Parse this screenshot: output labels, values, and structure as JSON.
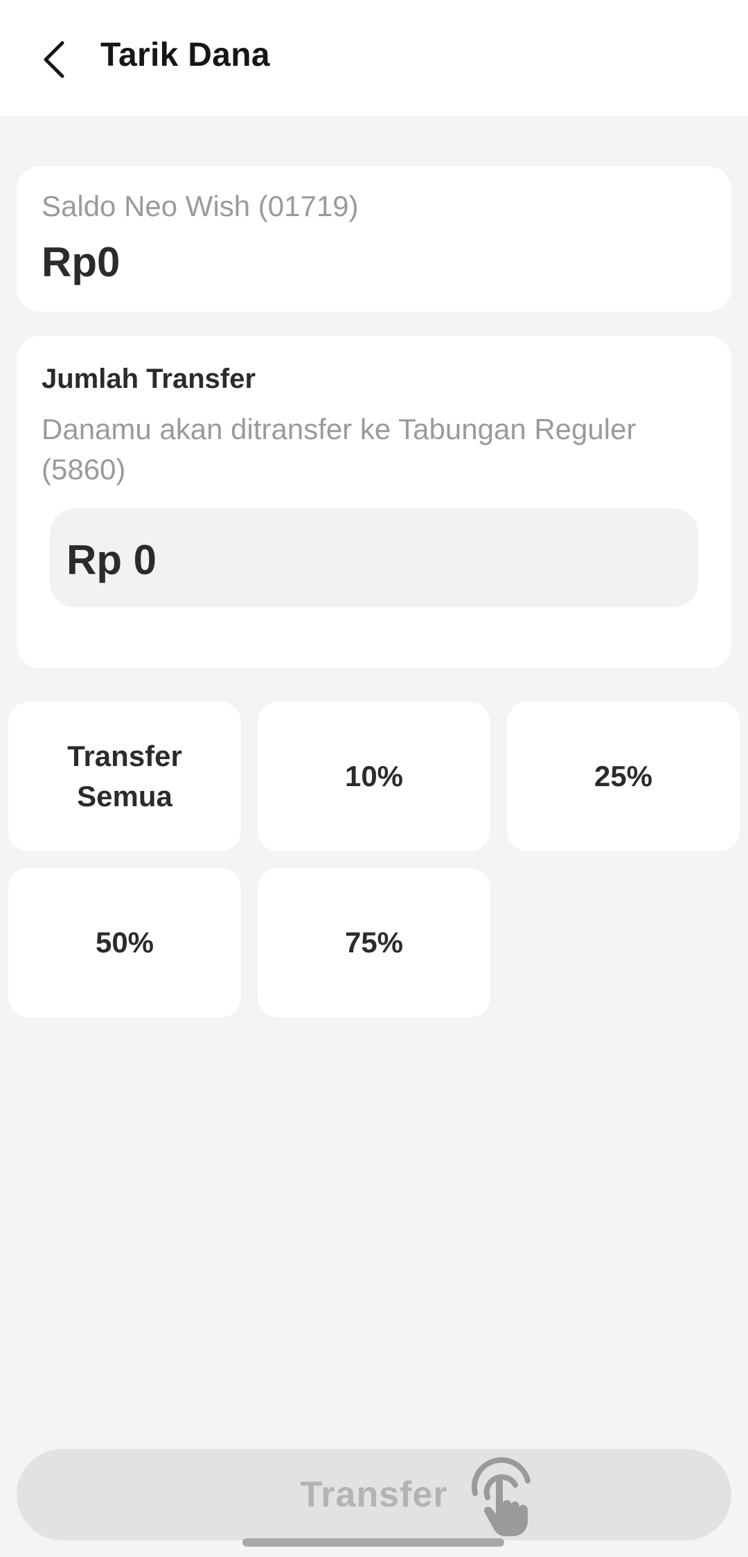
{
  "header": {
    "title": "Tarik Dana"
  },
  "balance": {
    "label": "Saldo Neo Wish (01719)",
    "value": "Rp0"
  },
  "transfer": {
    "title": "Jumlah Transfer",
    "description": "Danamu akan ditransfer ke Tabungan Reguler (5860)",
    "amount": "Rp 0"
  },
  "percent_options": [
    "Transfer Semua",
    "10%",
    "25%",
    "50%",
    "75%"
  ],
  "action": {
    "label": "Transfer"
  },
  "icons": {
    "back": "chevron-left-icon",
    "tap": "tap-hand-icon"
  }
}
